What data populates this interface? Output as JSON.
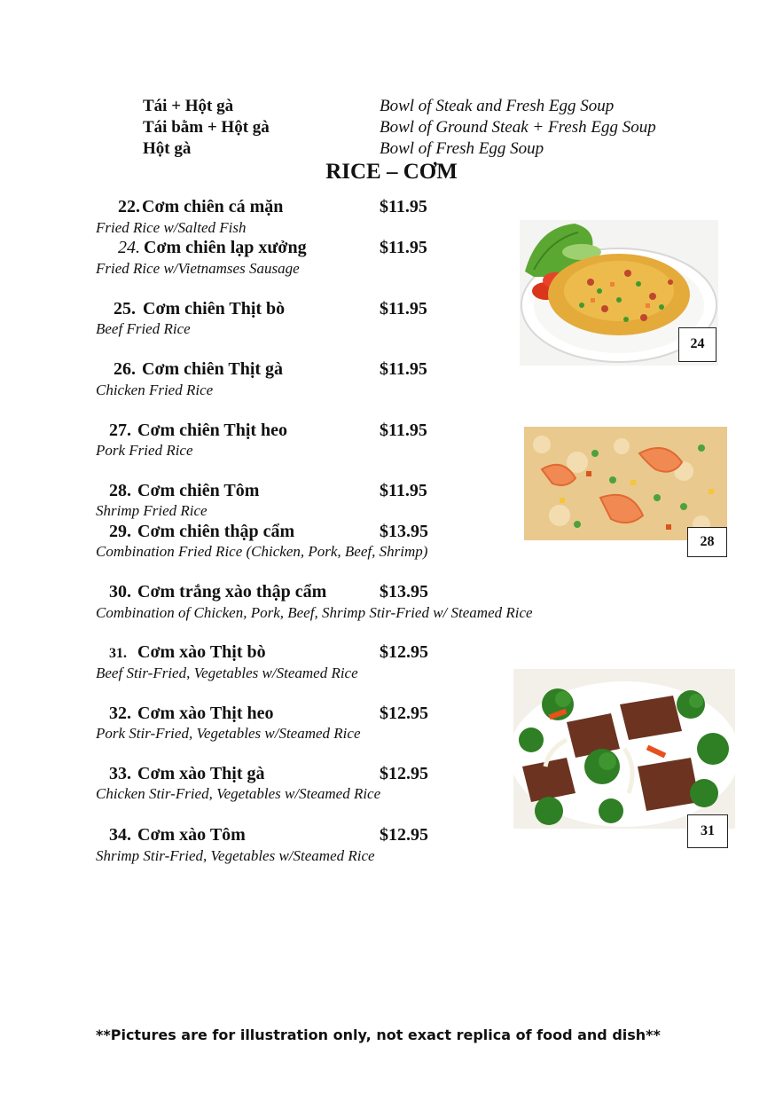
{
  "soups": [
    {
      "vn": "Tái + Hột gà",
      "en": "Bowl of Steak and Fresh Egg Soup"
    },
    {
      "vn": "Tái bằm + Hột gà",
      "en": "Bowl of Ground Steak + Fresh Egg Soup"
    },
    {
      "vn": "Hột gà",
      "en": "Bowl of Fresh Egg Soup"
    }
  ],
  "section_title": "RICE – CƠM",
  "items": [
    {
      "num": "22.",
      "name": "Cơm chiên cá mặn",
      "price": "$11.95",
      "desc": "Fried Rice w/Salted Fish"
    },
    {
      "num": "24.",
      "name": "Cơm chiên lạp xưởng",
      "price": "$11.95",
      "desc": "Fried Rice w/Vietnamses Sausage"
    },
    {
      "num": "25.",
      "name": "Cơm chiên Thịt bò",
      "price": "$11.95",
      "desc": "Beef Fried Rice"
    },
    {
      "num": "26.",
      "name": "Cơm chiên Thịt gà",
      "price": "$11.95",
      "desc": "Chicken Fried Rice"
    },
    {
      "num": "27.",
      "name": "Cơm chiên Thịt heo",
      "price": "$11.95",
      "desc": "Pork Fried Rice"
    },
    {
      "num": "28.",
      "name": "Cơm chiên Tôm",
      "price": "$11.95",
      "desc": "Shrimp Fried Rice"
    },
    {
      "num": "29.",
      "name": "Cơm chiên thập cẩm",
      "price": "$13.95",
      "desc": "Combination Fried Rice (Chicken, Pork, Beef, Shrimp)"
    },
    {
      "num": "30.",
      "name": "Cơm trắng xào thập cẩm",
      "price": "$13.95",
      "desc": "Combination of Chicken, Pork, Beef, Shrimp Stir-Fried w/ Steamed Rice"
    },
    {
      "num": "31.",
      "name": "Cơm xào Thịt bò",
      "price": "$12.95",
      "desc": "Beef Stir-Fried, Vegetables w/Steamed Rice"
    },
    {
      "num": "32.",
      "name": "Cơm xào Thịt heo",
      "price": "$12.95",
      "desc": "Pork Stir-Fried, Vegetables w/Steamed Rice"
    },
    {
      "num": "33.",
      "name": "Cơm xào Thịt gà",
      "price": "$12.95",
      "desc": "Chicken Stir-Fried, Vegetables w/Steamed Rice"
    },
    {
      "num": "34.",
      "name": "Cơm xào Tôm",
      "price": "$12.95",
      "desc": "Shrimp Stir-Fried, Vegetables w/Steamed Rice"
    }
  ],
  "photos": [
    {
      "label": "24"
    },
    {
      "label": "28"
    },
    {
      "label": "31"
    }
  ],
  "footer_note": "**Pictures are for illustration only, not exact replica of food and dish**"
}
